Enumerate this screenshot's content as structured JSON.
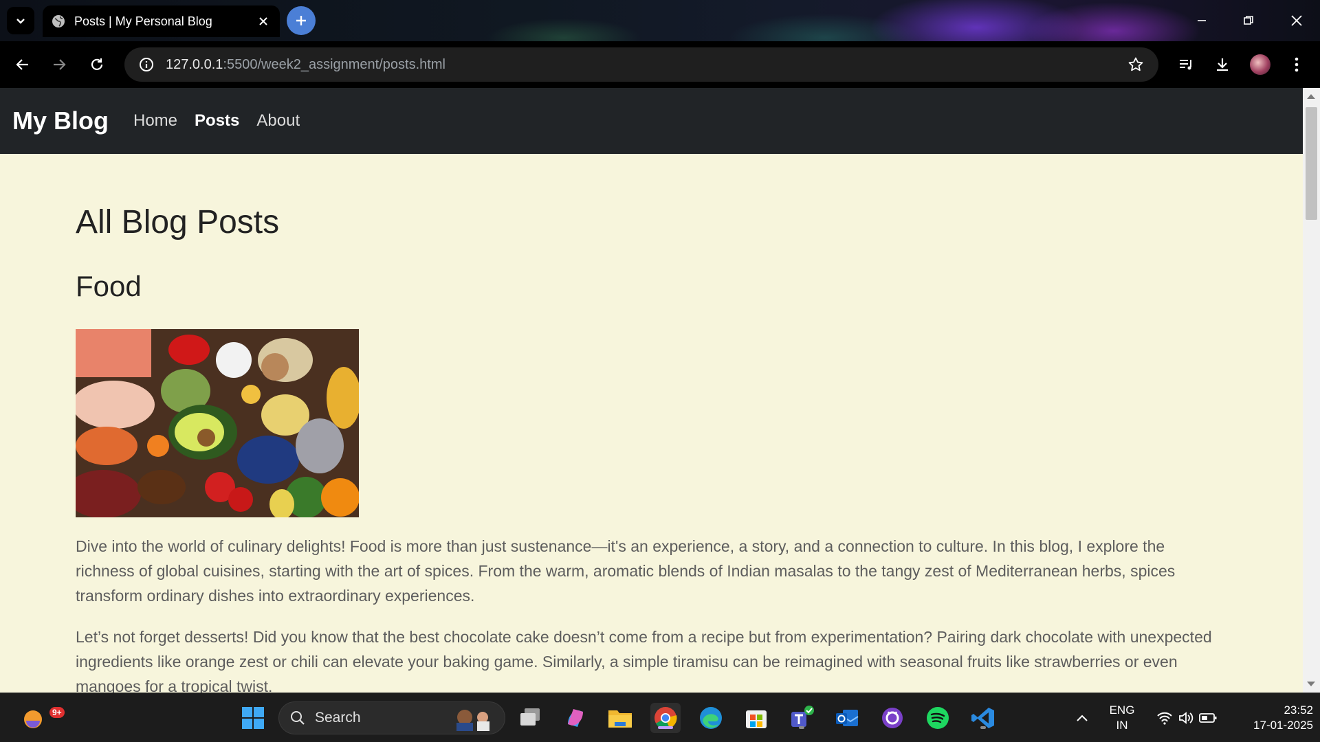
{
  "browser": {
    "tab": {
      "title": "Posts | My Personal Blog"
    },
    "address_bar": {
      "host": "127.0.0.1",
      "rest": ":5500/week2_assignment/posts.html"
    }
  },
  "site": {
    "brand": "My Blog",
    "nav": [
      {
        "label": "Home",
        "active": false
      },
      {
        "label": "Posts",
        "active": true
      },
      {
        "label": "About",
        "active": false
      }
    ]
  },
  "main": {
    "page_title": "All Blog Posts",
    "posts": [
      {
        "title": "Food",
        "paragraphs": [
          "Dive into the world of culinary delights! Food is more than just sustenance—it's an experience, a story, and a connection to culture. In this blog, I explore the richness of global cuisines, starting with the art of spices. From the warm, aromatic blends of Indian masalas to the tangy zest of Mediterranean herbs, spices transform ordinary dishes into extraordinary experiences.",
          "Let’s not forget desserts! Did you know that the best chocolate cake doesn’t come from a recipe but from experimentation? Pairing dark chocolate with unexpected ingredients like orange zest or chili can elevate your baking game. Similarly, a simple tiramisu can be reimagined with seasonal fruits like strawberries or even mangoes for a tropical twist."
        ]
      }
    ]
  },
  "taskbar": {
    "notification_badge": "9+",
    "search_label": "Search",
    "language": "ENG",
    "region": "IN",
    "time": "23:52",
    "date": "17-01-2025"
  },
  "colors": {
    "page_background": "#f7f5dc",
    "navbar_background": "#212427",
    "new_tab_button": "#4b7fd6"
  }
}
